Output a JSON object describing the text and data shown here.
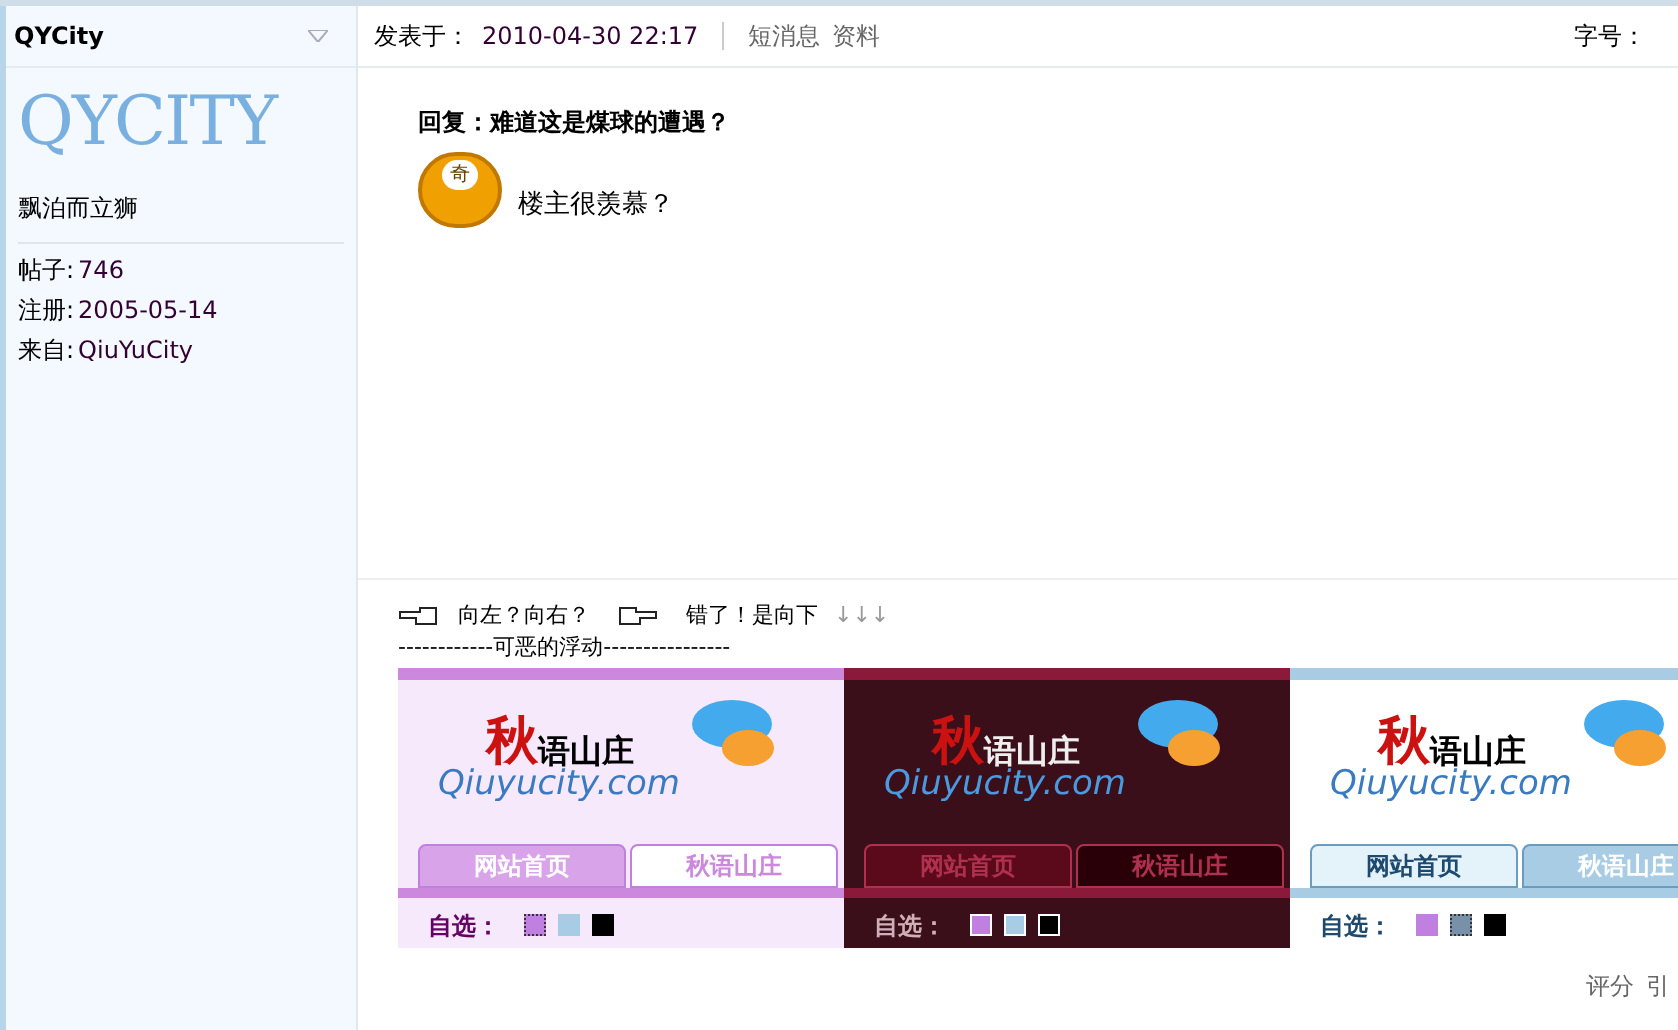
{
  "sidebar": {
    "username": "QYCity",
    "logo": "QYCITY",
    "nickname": "飘泊而立狮",
    "stats": [
      {
        "label": "帖子:",
        "value": "746"
      },
      {
        "label": "注册:",
        "value": "2005-05-14"
      },
      {
        "label": "来自:",
        "value": "QiuYuCity"
      }
    ]
  },
  "post_header": {
    "posted_label": "发表于：",
    "posted_time": "2010-04-30 22:17",
    "links": [
      "短消息",
      "资料"
    ],
    "font_size_label": "字号："
  },
  "post": {
    "title": "回复：难道这是煤球的遭遇？",
    "emoticon_text": "奇",
    "message": "楼主很羡慕？"
  },
  "signature": {
    "line1": [
      "向左？向右？",
      "错了！是向下"
    ],
    "arrows": "↓↓↓",
    "line2": "------------可恶的浮动----------------",
    "themes": [
      {
        "kind": "purple",
        "logo_main": "秋",
        "logo_sub": "语山庄",
        "logo_url": "Qiuyucity.com",
        "tabs": [
          {
            "label": "网站首页",
            "selected": true
          },
          {
            "label": "秋语山庄",
            "selected": false
          }
        ],
        "pick_label": "自选：",
        "swatches": [
          {
            "color": "#c080e0",
            "selected": true
          },
          {
            "color": "#a8cce4",
            "selected": false
          },
          {
            "color": "#000000",
            "selected": false
          }
        ]
      },
      {
        "kind": "dark",
        "logo_main": "秋",
        "logo_sub": "语山庄",
        "logo_url": "Qiuyucity.com",
        "tabs": [
          {
            "label": "网站首页",
            "selected": true
          },
          {
            "label": "秋语山庄",
            "selected": false
          }
        ],
        "pick_label": "自选：",
        "swatches": [
          {
            "color": "#c080e0",
            "selected": false
          },
          {
            "color": "#a8cce4",
            "selected": false
          },
          {
            "color": "#000000",
            "selected": false
          }
        ]
      },
      {
        "kind": "blue",
        "logo_main": "秋",
        "logo_sub": "语山庄",
        "logo_url": "Qiuyucity.com",
        "tabs": [
          {
            "label": "网站首页",
            "selected": true
          },
          {
            "label": "秋语山庄",
            "selected": false
          }
        ],
        "pick_label": "自选：",
        "swatches": [
          {
            "color": "#c080e0",
            "selected": false
          },
          {
            "color": "#7890a8",
            "selected": true
          },
          {
            "color": "#000000",
            "selected": false
          }
        ]
      }
    ]
  },
  "footer_links": [
    "评分",
    "引"
  ]
}
